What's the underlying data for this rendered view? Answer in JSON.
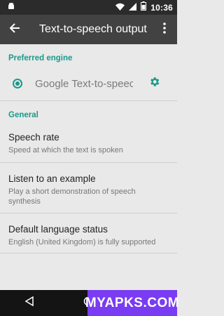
{
  "status_bar": {
    "time": "10:36",
    "icons": [
      "android-icon",
      "wifi-icon",
      "signal-icon",
      "battery-icon"
    ]
  },
  "app_bar": {
    "title": "Text-to-speech output",
    "back_icon": "arrow-back-icon",
    "overflow_icon": "more-vert-icon"
  },
  "preferred_engine": {
    "header": "Preferred engine",
    "engine_name": "Google Text-to-speec..",
    "selected": true
  },
  "general": {
    "header": "General",
    "items": [
      {
        "title": "Speech rate",
        "summary": "Speed at which the text is spoken"
      },
      {
        "title": "Listen to an example",
        "summary": "Play a short demonstration of speech synthesis"
      },
      {
        "title": "Default language status",
        "summary": "English (United Kingdom) is fully supported"
      }
    ]
  },
  "nav_bar": {
    "buttons": [
      "back-triangle-icon",
      "home-circle-icon",
      "recents-square-icon"
    ]
  },
  "watermark": {
    "text": "MYAPKS.COM"
  },
  "colors": {
    "accent": "#1a9a8a",
    "app_bar": "#424242",
    "watermark": "#7a3cf2"
  }
}
